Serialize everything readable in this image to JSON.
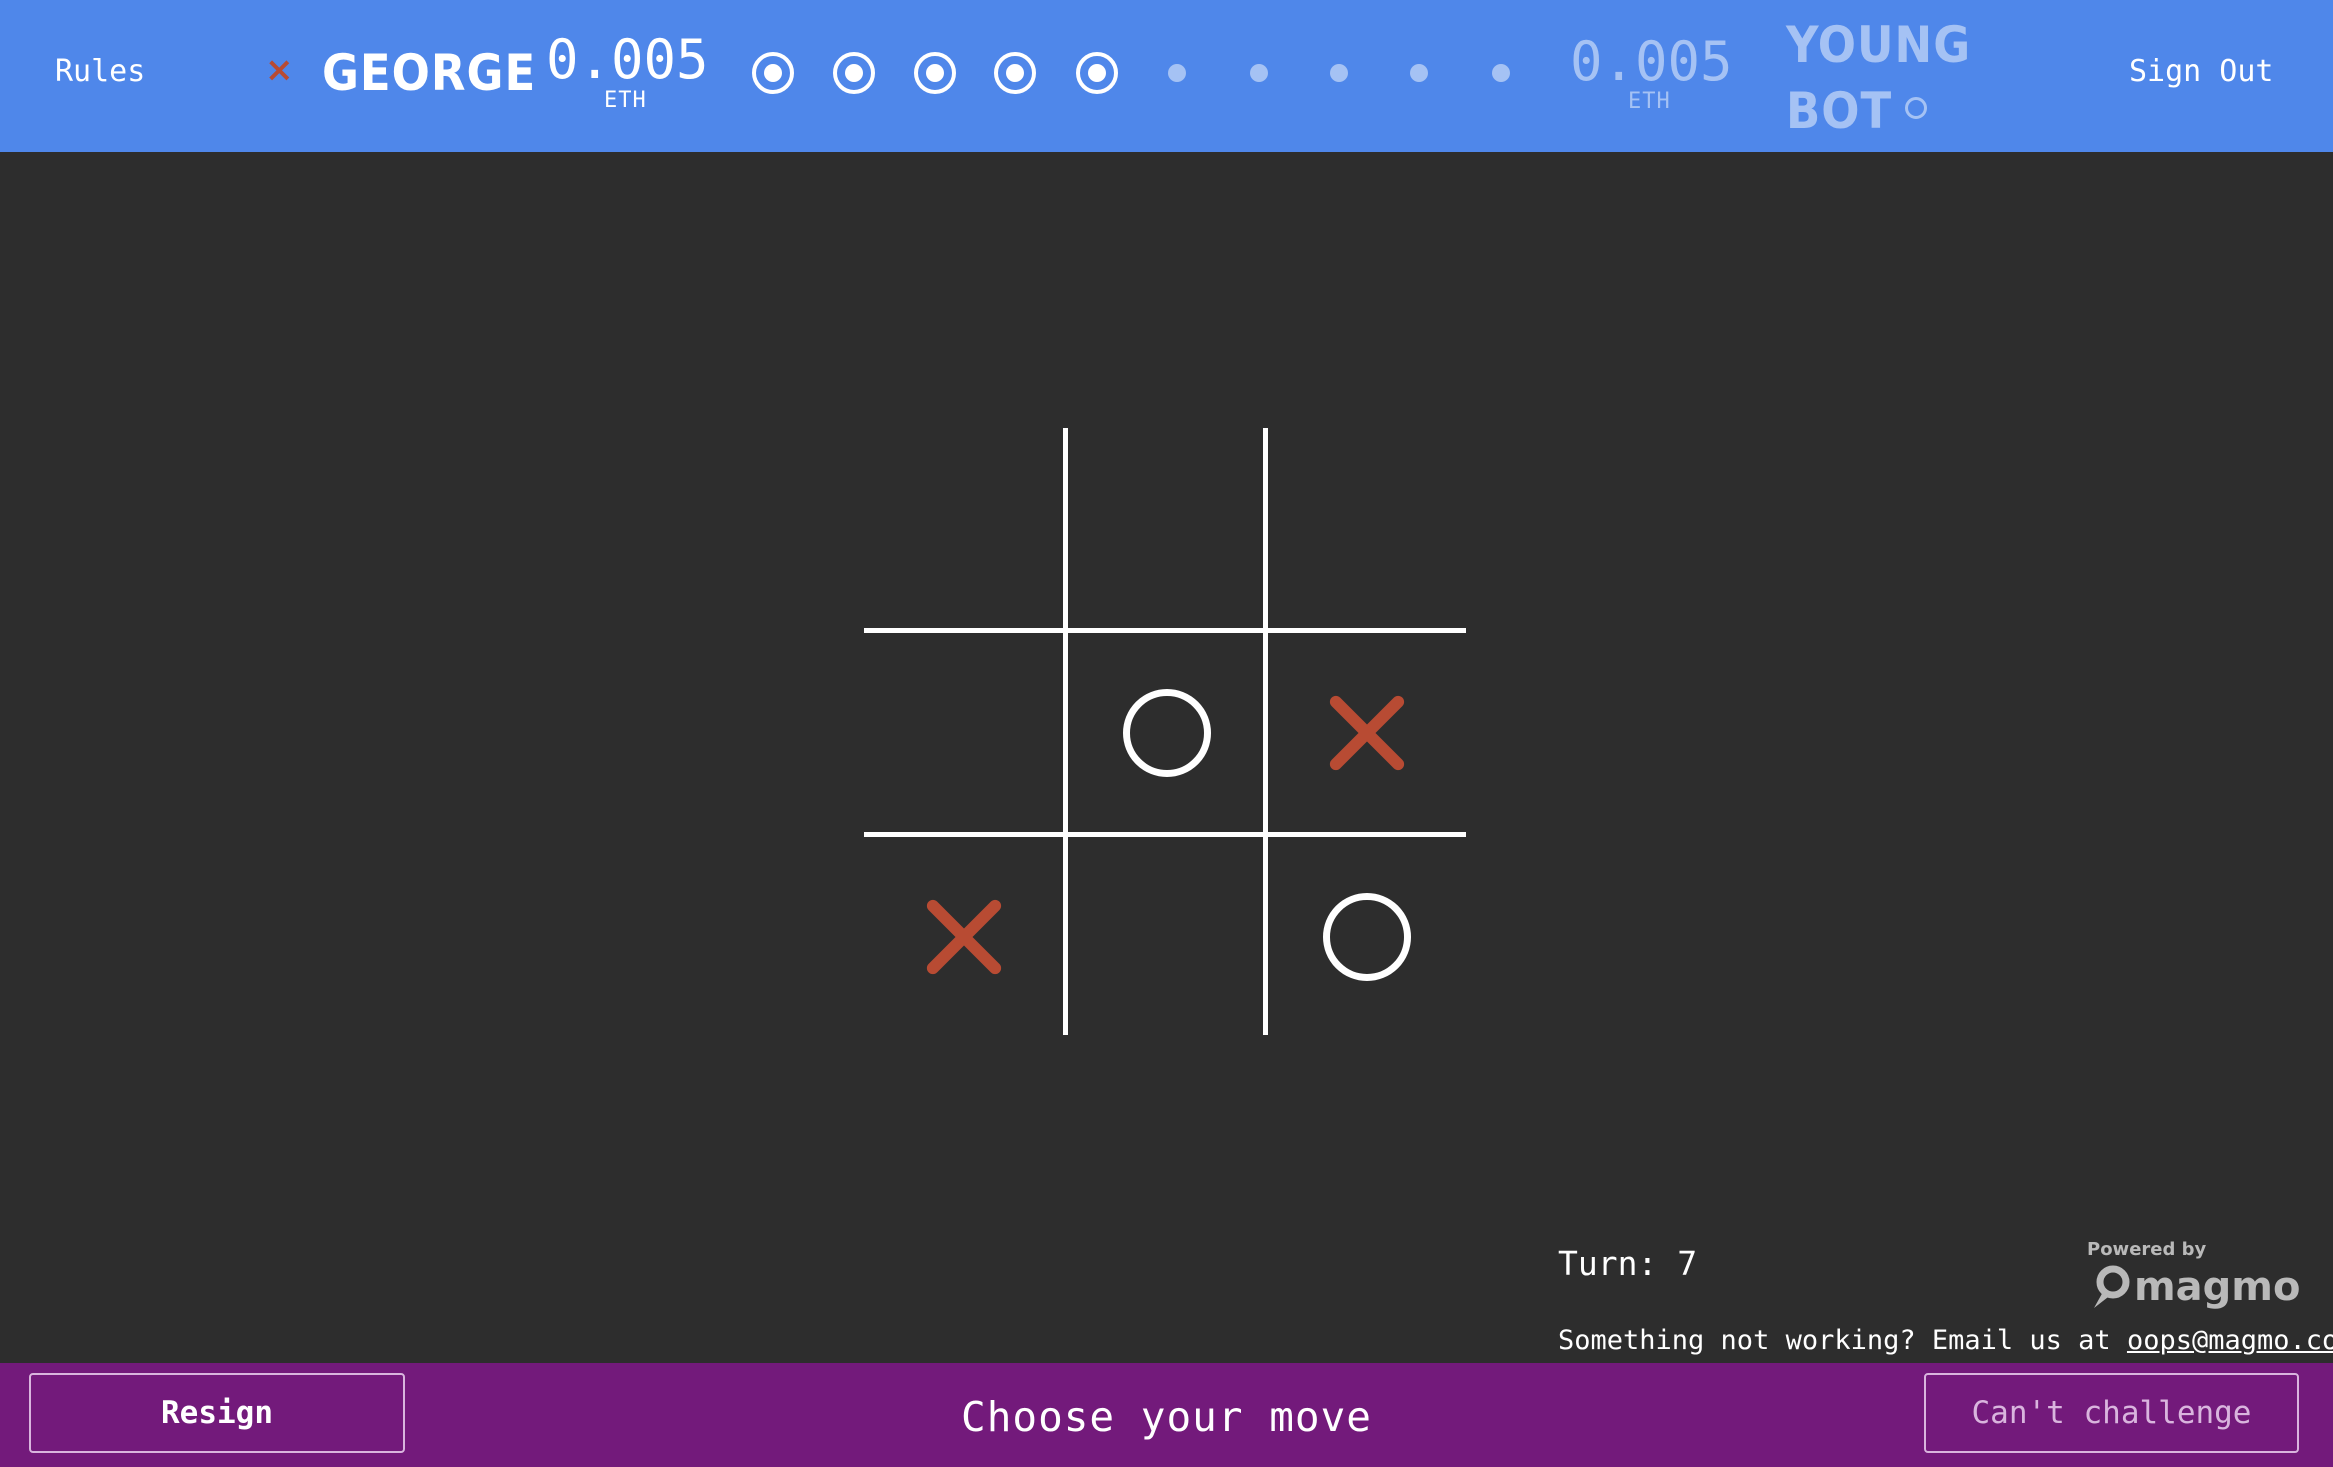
{
  "header": {
    "rules_label": "Rules",
    "signout_label": "Sign Out",
    "player1": {
      "mark": "×",
      "name": "GEORGE",
      "stake": "0.005",
      "unit": "ETH"
    },
    "player2": {
      "name_line1": "YOUNG",
      "name_line2": "BOT",
      "stake": "0.005",
      "unit": "ETH"
    },
    "rounds": [
      "done",
      "done",
      "done",
      "done",
      "done",
      "pending",
      "pending",
      "pending",
      "pending",
      "pending"
    ]
  },
  "board": {
    "cells": [
      "",
      "",
      "",
      "",
      "O",
      "X",
      "X",
      "",
      "O"
    ]
  },
  "info": {
    "turn": "Turn: 7",
    "help_text": "Something not working? Email us at ",
    "help_email": "oops@magmo.com",
    "powered_by": "Powered by",
    "brand": "magmo"
  },
  "footer": {
    "resign_label": "Resign",
    "status": "Choose your move",
    "challenge_label": "Can't challenge"
  },
  "colors": {
    "header_bg": "#4f87ea",
    "footer_bg": "#731a7b",
    "board_bg": "#2d2d2d",
    "x_color": "#b84b33",
    "o_color": "#ffffff",
    "opponent_muted": "#a5c2f4"
  }
}
